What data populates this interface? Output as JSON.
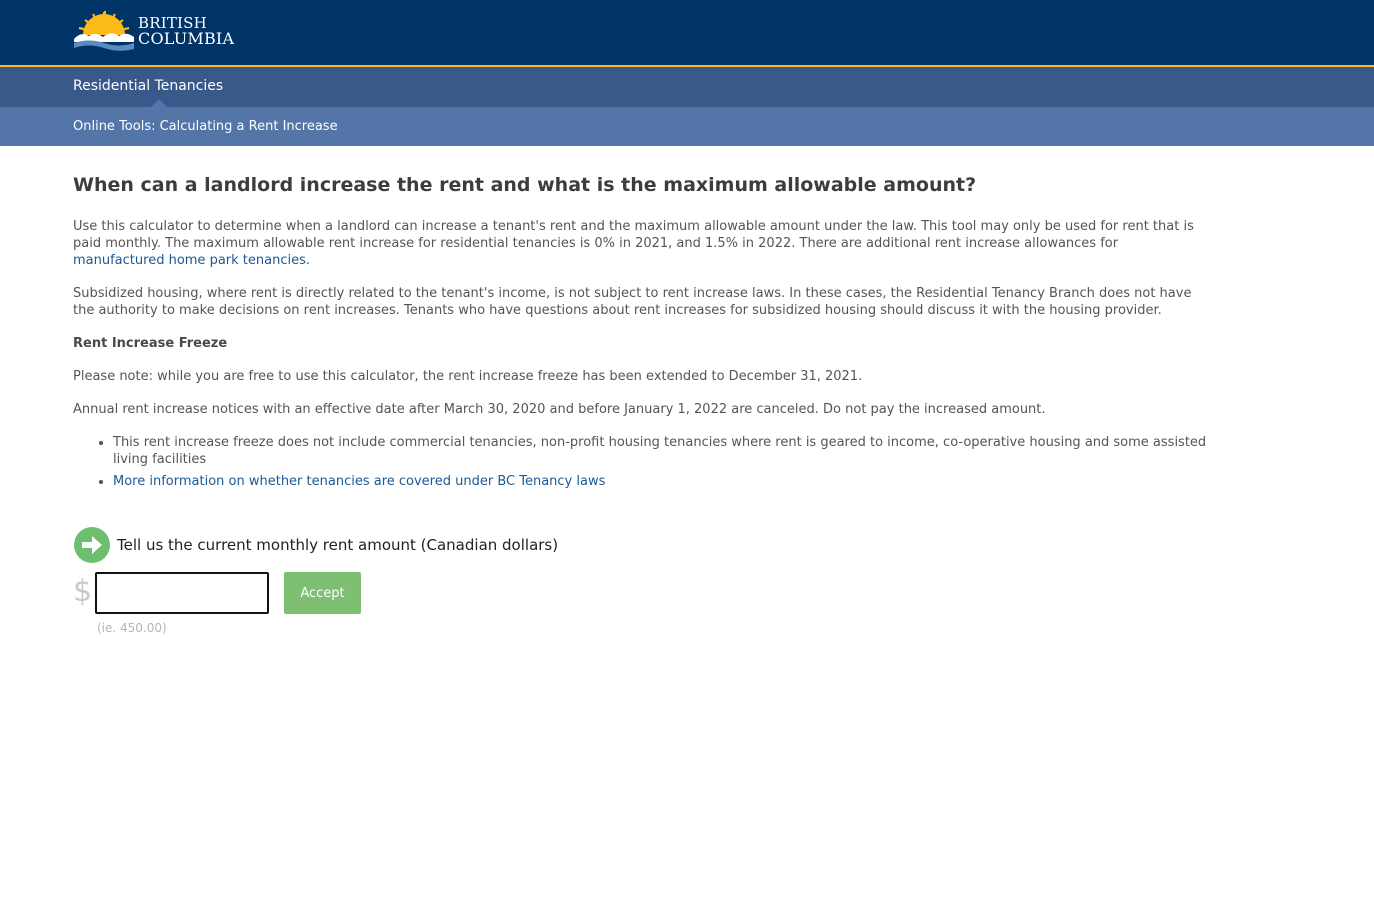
{
  "header": {
    "logo_line1": "BRITISH",
    "logo_line2": "COLUMBIA",
    "brand_color": "#003366",
    "accent_color": "#fcba19"
  },
  "nav": {
    "primary_label": "Residential Tenancies",
    "secondary_label": "Online Tools: Calculating a Rent Increase"
  },
  "main": {
    "heading": "When can a landlord increase the rent and what is the maximum allowable amount?",
    "intro_text": "Use this calculator to determine when a landlord can increase a tenant's rent and the maximum allowable amount under the law. This tool may only be used for rent that is paid monthly. The maximum allowable rent increase for residential tenancies is 0% in 2021, and 1.5% in 2022. There are additional rent increase allowances for ",
    "intro_link": "manufactured home park tenancies.",
    "subsidized_text": "Subsidized housing, where rent is directly related to the tenant's income, is not subject to rent increase laws. In these cases, the Residential Tenancy Branch does not have the authority to make decisions on rent increases. Tenants who have questions about rent increases for subsidized housing should discuss it with the housing provider.",
    "freeze_heading": "Rent Increase Freeze",
    "freeze_note": "Please note: while you are free to use this calculator, the rent increase freeze has been extended to December 31, 2021.",
    "notices_text": "Annual rent increase notices with an effective date after March 30, 2020 and before January 1, 2022 are canceled. Do not pay the increased amount.",
    "bullet1": "This rent increase freeze does not include commercial tenancies, non-profit housing tenancies where rent is geared to income, co-operative housing and some assisted living facilities",
    "bullet2_link": "More information on whether tenancies are covered under BC Tenancy laws"
  },
  "form": {
    "step_icon": "arrow-right-circle-icon",
    "question_label": "Tell us the current monthly rent amount (Canadian dollars)",
    "currency_symbol": "$",
    "rent_value": "",
    "rent_placeholder": "",
    "accept_label": "Accept",
    "hint": "(ie. 450.00)",
    "accept_color": "#7ebf74"
  }
}
